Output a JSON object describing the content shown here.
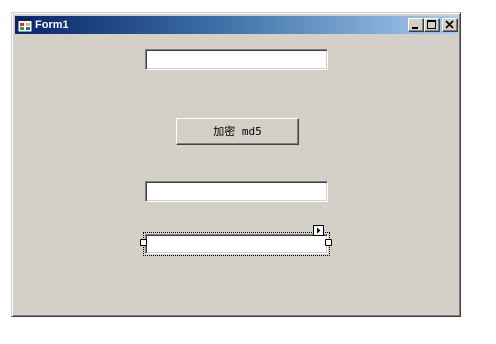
{
  "window": {
    "title": "Form1",
    "icon": "winforms-form-icon"
  },
  "caption_buttons": {
    "minimize_icon": "minimize-icon",
    "maximize_icon": "maximize-icon",
    "close_icon": "close-icon"
  },
  "form": {
    "textbox_top": {
      "value": "",
      "placeholder": ""
    },
    "encrypt_button": {
      "label": "加密 md5"
    },
    "textbox_middle": {
      "value": "",
      "placeholder": ""
    },
    "textbox_selected": {
      "value": "",
      "placeholder": ""
    },
    "smart_tag_icon": "smart-tag-arrow-icon"
  },
  "colors": {
    "form_background": "#d4d0c8",
    "titlebar_start": "#0a246a",
    "titlebar_end": "#a6caf0"
  }
}
